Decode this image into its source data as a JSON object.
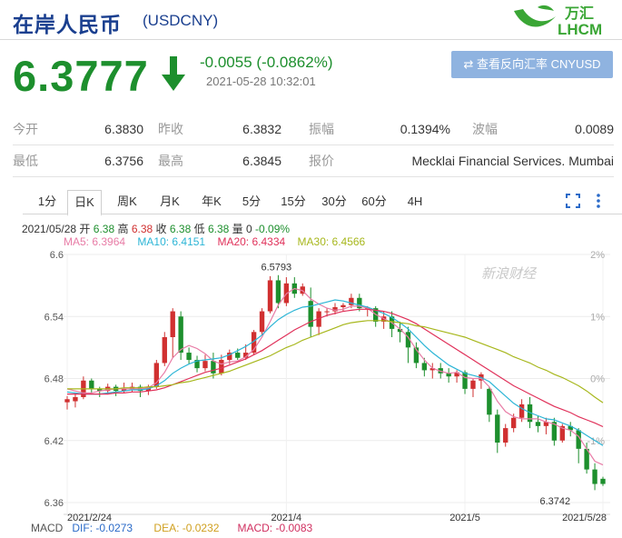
{
  "header": {
    "title": "在岸人民币",
    "code": "(USDCNY)",
    "logo_cn": "万汇",
    "logo_en": "LHCM"
  },
  "quote": {
    "price": "6.3777",
    "change": "-0.0055 (-0.0862%)",
    "timestamp": "2021-05-28 10:32:01",
    "reverse_button": "查看反向汇率 CNYUSD"
  },
  "stats": [
    [
      {
        "label": "今开",
        "value": "6.3830"
      },
      {
        "label": "昨收",
        "value": "6.3832"
      },
      {
        "label": "振幅",
        "value": "0.1394%"
      },
      {
        "label": "波幅",
        "value": "0.0089"
      }
    ],
    [
      {
        "label": "最低",
        "value": "6.3756"
      },
      {
        "label": "最高",
        "value": "6.3845"
      },
      {
        "label": "报价",
        "value": "Mecklai Financial Services. Mumbai"
      }
    ]
  ],
  "tabs": [
    "1分",
    "日K",
    "周K",
    "月K",
    "年K",
    "5分",
    "15分",
    "30分",
    "60分",
    "4H"
  ],
  "active_tab": "日K",
  "ohlc_line": {
    "date": "2021/05/28",
    "open_label": "开",
    "open": "6.38",
    "high_label": "高",
    "high": "6.38",
    "close_label": "收",
    "close": "6.38",
    "low_label": "低",
    "low": "6.38",
    "vol_label": "量",
    "vol": "0",
    "pct": "-0.09%"
  },
  "ma_legend": [
    {
      "text": "MA5: 6.3964",
      "color": "#e87ca6"
    },
    {
      "text": "MA10: 6.4151",
      "color": "#2cb5d6"
    },
    {
      "text": "MA20: 6.4334",
      "color": "#e0315a"
    },
    {
      "text": "MA30: 6.4566",
      "color": "#a7b71c"
    }
  ],
  "macd_legend": {
    "label": "MACD",
    "dif": "DIF: -0.0273",
    "dea": "DEA: -0.0232",
    "macd": "MACD: -0.0083"
  },
  "watermark": "新浪财经",
  "colors": {
    "up": "#d03030",
    "down": "#1d8f2d",
    "accent": "#1a3f8f"
  },
  "chart_data": {
    "type": "candlestick",
    "ylim": [
      6.36,
      6.6
    ],
    "yticks": [
      "6.6",
      "6.54",
      "6.48",
      "6.42",
      "6.36"
    ],
    "pct_ticks": [
      "2%",
      "1%",
      "0%",
      "-1%"
    ],
    "xtick_labels": [
      "2021/2/24",
      "2021/4",
      "2021/5",
      "2021/5/28"
    ],
    "xtick_index": [
      0,
      27,
      49,
      66
    ],
    "annotations": [
      {
        "text": "6.5793",
        "index": 25,
        "value": 6.5793
      },
      {
        "text": "6.3742",
        "index": 64,
        "value": 6.3742
      }
    ],
    "candles": [
      [
        6.457,
        6.46,
        6.463,
        6.45
      ],
      [
        6.458,
        6.462,
        6.465,
        6.452
      ],
      [
        6.462,
        6.478,
        6.482,
        6.46
      ],
      [
        6.478,
        6.47,
        6.48,
        6.466
      ],
      [
        6.47,
        6.468,
        6.472,
        6.462
      ],
      [
        6.468,
        6.472,
        6.475,
        6.465
      ],
      [
        6.472,
        6.468,
        6.474,
        6.463
      ],
      [
        6.468,
        6.47,
        6.476,
        6.466
      ],
      [
        6.47,
        6.472,
        6.476,
        6.467
      ],
      [
        6.472,
        6.468,
        6.474,
        6.462
      ],
      [
        6.468,
        6.472,
        6.474,
        6.464
      ],
      [
        6.472,
        6.495,
        6.498,
        6.47
      ],
      [
        6.495,
        6.52,
        6.525,
        6.492
      ],
      [
        6.52,
        6.545,
        6.548,
        6.5
      ],
      [
        6.54,
        6.505,
        6.545,
        6.498
      ],
      [
        6.505,
        6.498,
        6.51,
        6.494
      ],
      [
        6.498,
        6.49,
        6.502,
        6.486
      ],
      [
        6.49,
        6.497,
        6.503,
        6.487
      ],
      [
        6.497,
        6.485,
        6.505,
        6.48
      ],
      [
        6.485,
        6.498,
        6.503,
        6.483
      ],
      [
        6.498,
        6.505,
        6.508,
        6.494
      ],
      [
        6.505,
        6.5,
        6.509,
        6.498
      ],
      [
        6.5,
        6.505,
        6.513,
        6.498
      ],
      [
        6.505,
        6.525,
        6.527,
        6.503
      ],
      [
        6.525,
        6.545,
        6.548,
        6.522
      ],
      [
        6.545,
        6.575,
        6.579,
        6.543
      ],
      [
        6.575,
        6.553,
        6.58,
        6.548
      ],
      [
        6.553,
        6.572,
        6.578,
        6.55
      ],
      [
        6.572,
        6.562,
        6.578,
        6.558
      ],
      [
        6.562,
        6.569,
        6.572,
        6.56
      ],
      [
        6.555,
        6.53,
        6.568,
        6.52
      ],
      [
        6.53,
        6.545,
        6.548,
        6.522
      ],
      [
        6.545,
        6.545,
        6.548,
        6.54
      ],
      [
        6.545,
        6.549,
        6.553,
        6.542
      ],
      [
        6.549,
        6.551,
        6.553,
        6.545
      ],
      [
        6.551,
        6.558,
        6.562,
        6.548
      ],
      [
        6.558,
        6.548,
        6.562,
        6.545
      ],
      [
        6.548,
        6.548,
        6.55,
        6.54
      ],
      [
        6.548,
        6.535,
        6.55,
        6.53
      ],
      [
        6.535,
        6.54,
        6.545,
        6.528
      ],
      [
        6.54,
        6.528,
        6.545,
        6.52
      ],
      [
        6.528,
        6.525,
        6.535,
        6.515
      ],
      [
        6.525,
        6.51,
        6.53,
        6.495
      ],
      [
        6.51,
        6.495,
        6.515,
        6.49
      ],
      [
        6.495,
        6.488,
        6.5,
        6.482
      ],
      [
        6.488,
        6.49,
        6.495,
        6.48
      ],
      [
        6.49,
        6.485,
        6.495,
        6.48
      ],
      [
        6.485,
        6.482,
        6.49,
        6.476
      ],
      [
        6.482,
        6.486,
        6.488,
        6.476
      ],
      [
        6.486,
        6.47,
        6.488,
        6.465
      ],
      [
        6.47,
        6.478,
        6.48,
        6.462
      ],
      [
        6.478,
        6.484,
        6.486,
        6.47
      ],
      [
        6.47,
        6.445,
        6.472,
        6.438
      ],
      [
        6.445,
        6.418,
        6.45,
        6.408
      ],
      [
        6.418,
        6.432,
        6.436,
        6.414
      ],
      [
        6.432,
        6.442,
        6.446,
        6.428
      ],
      [
        6.442,
        6.455,
        6.46,
        6.438
      ],
      [
        6.455,
        6.438,
        6.462,
        6.432
      ],
      [
        6.438,
        6.434,
        6.444,
        6.428
      ],
      [
        6.434,
        6.438,
        6.442,
        6.426
      ],
      [
        6.438,
        6.42,
        6.442,
        6.415
      ],
      [
        6.42,
        6.434,
        6.436,
        6.418
      ],
      [
        6.434,
        6.43,
        6.438,
        6.424
      ],
      [
        6.43,
        6.412,
        6.432,
        6.398
      ],
      [
        6.412,
        6.392,
        6.418,
        6.388
      ],
      [
        6.392,
        6.378,
        6.398,
        6.372
      ],
      [
        6.383,
        6.378,
        6.385,
        6.376
      ]
    ],
    "series": [
      {
        "name": "MA5",
        "color": "#e87ca6",
        "values": [
          6.47,
          6.468,
          6.466,
          6.466,
          6.468,
          6.469,
          6.47,
          6.47,
          6.47,
          6.47,
          6.471,
          6.476,
          6.486,
          6.5,
          6.508,
          6.512,
          6.509,
          6.504,
          6.497,
          6.494,
          6.496,
          6.497,
          6.501,
          6.508,
          6.52,
          6.535,
          6.551,
          6.562,
          6.567,
          6.565,
          6.557,
          6.552,
          6.548,
          6.546,
          6.547,
          6.55,
          6.55,
          6.548,
          6.542,
          6.538,
          6.534,
          6.528,
          6.52,
          6.508,
          6.498,
          6.49,
          6.487,
          6.485,
          6.486,
          6.481,
          6.48,
          6.48,
          6.472,
          6.458,
          6.448,
          6.443,
          6.441,
          6.441,
          6.441,
          6.438,
          6.436,
          6.432,
          6.43,
          6.424,
          6.412,
          6.4,
          6.3964
        ]
      },
      {
        "name": "MA10",
        "color": "#2cb5d6",
        "values": [
          6.467,
          6.466,
          6.465,
          6.465,
          6.465,
          6.466,
          6.467,
          6.468,
          6.469,
          6.469,
          6.47,
          6.473,
          6.478,
          6.485,
          6.49,
          6.494,
          6.497,
          6.498,
          6.499,
          6.5,
          6.503,
          6.507,
          6.511,
          6.516,
          6.522,
          6.53,
          6.537,
          6.542,
          6.546,
          6.549,
          6.55,
          6.552,
          6.554,
          6.556,
          6.555,
          6.553,
          6.551,
          6.549,
          6.546,
          6.543,
          6.539,
          6.534,
          6.528,
          6.52,
          6.512,
          6.505,
          6.499,
          6.493,
          6.489,
          6.485,
          6.483,
          6.481,
          6.477,
          6.47,
          6.463,
          6.456,
          6.451,
          6.447,
          6.444,
          6.441,
          6.44,
          6.437,
          6.434,
          6.43,
          6.425,
          6.42,
          6.4151
        ]
      },
      {
        "name": "MA20",
        "color": "#e0315a",
        "values": [
          6.465,
          6.465,
          6.465,
          6.465,
          6.465,
          6.465,
          6.466,
          6.466,
          6.467,
          6.467,
          6.468,
          6.469,
          6.471,
          6.474,
          6.477,
          6.48,
          6.483,
          6.486,
          6.488,
          6.49,
          6.493,
          6.496,
          6.499,
          6.503,
          6.507,
          6.512,
          6.517,
          6.522,
          6.527,
          6.531,
          6.535,
          6.538,
          6.541,
          6.543,
          6.545,
          6.546,
          6.547,
          6.547,
          6.546,
          6.545,
          6.543,
          6.54,
          6.537,
          6.533,
          6.528,
          6.523,
          6.518,
          6.513,
          6.508,
          6.503,
          6.498,
          6.493,
          6.488,
          6.483,
          6.478,
          6.473,
          6.469,
          6.465,
          6.461,
          6.457,
          6.453,
          6.45,
          6.447,
          6.443,
          6.44,
          6.437,
          6.4334
        ]
      },
      {
        "name": "MA30",
        "color": "#a7b71c",
        "values": [
          6.47,
          6.47,
          6.47,
          6.47,
          6.47,
          6.47,
          6.47,
          6.471,
          6.471,
          6.471,
          6.472,
          6.472,
          6.473,
          6.474,
          6.476,
          6.477,
          6.479,
          6.481,
          6.483,
          6.485,
          6.487,
          6.49,
          6.493,
          6.496,
          6.499,
          6.502,
          6.506,
          6.51,
          6.513,
          6.517,
          6.52,
          6.523,
          6.526,
          6.529,
          6.532,
          6.534,
          6.535,
          6.536,
          6.536,
          6.536,
          6.535,
          6.534,
          6.533,
          6.531,
          6.53,
          6.528,
          6.526,
          6.524,
          6.522,
          6.52,
          6.517,
          6.514,
          6.511,
          6.508,
          6.505,
          6.501,
          6.498,
          6.495,
          6.491,
          6.488,
          6.484,
          6.481,
          6.477,
          6.473,
          6.468,
          6.462,
          6.4566
        ]
      }
    ]
  }
}
